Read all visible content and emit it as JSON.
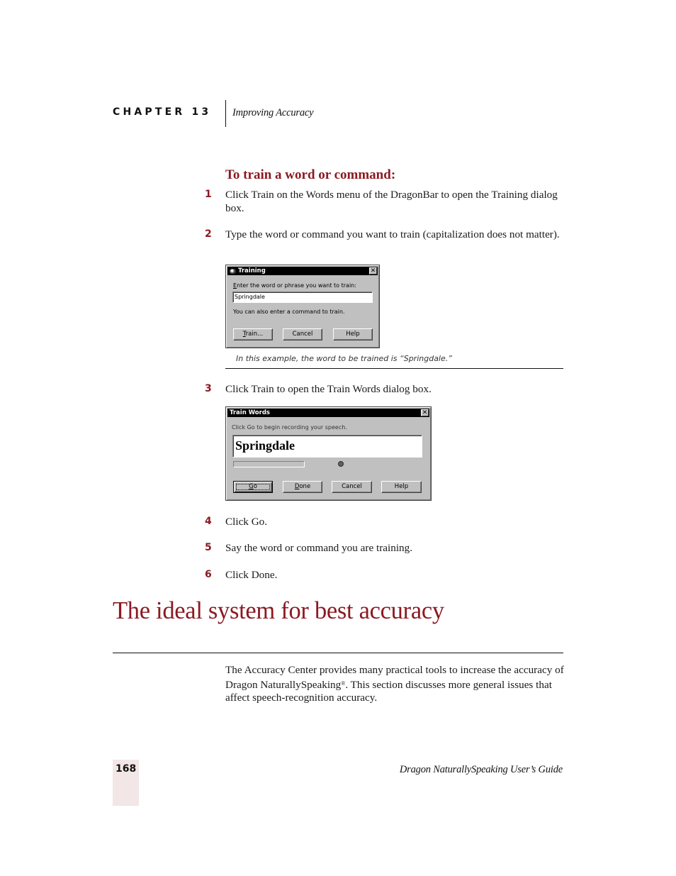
{
  "header": {
    "chapter_label": "CHAPTER 13",
    "chapter_title": "Improving Accuracy"
  },
  "procedure": {
    "heading": "To train a word or command:",
    "steps": [
      {
        "num": "1",
        "text": "Click Train on the Words menu of the DragonBar to open the Training dialog box."
      },
      {
        "num": "2",
        "text": "Type the word or command you want to train (capitalization does not matter)."
      },
      {
        "num": "3",
        "text": "Click Train to open the Train Words dialog box."
      },
      {
        "num": "4",
        "text": "Click Go."
      },
      {
        "num": "5",
        "text": "Say the word or command you are training."
      },
      {
        "num": "6",
        "text": "Click Done."
      }
    ]
  },
  "training_dialog": {
    "title": "Training",
    "close_symbol": "✕",
    "prompt_first": "E",
    "prompt_rest": "nter the word or phrase you want to train:",
    "input_value": "Springdale",
    "hint": "You can also enter a command to train.",
    "buttons": {
      "train_first": "T",
      "train_rest": "rain...",
      "cancel": "Cancel",
      "help": "Help"
    },
    "caption": "In this example, the word to be trained is “Springdale.”"
  },
  "train_words_dialog": {
    "title": "Train Words",
    "close_symbol": "✕",
    "instruction": "Click Go to begin recording your speech.",
    "word": "Springdale",
    "progress_percent": 0,
    "buttons": {
      "go_first": "G",
      "go_rest": "o",
      "done_first": "D",
      "done_rest": "one",
      "cancel": "Cancel",
      "help": "Help"
    }
  },
  "section": {
    "heading": "The ideal system for best accuracy",
    "body_before_reg": "The Accuracy Center provides many practical tools to increase the accuracy of Dragon NaturallySpeaking",
    "reg_mark": "®",
    "body_after_reg": ". This section discusses more general issues that affect speech-recognition accuracy."
  },
  "footer": {
    "page_number": "168",
    "book_title": "Dragon NaturallySpeaking User’s Guide"
  }
}
